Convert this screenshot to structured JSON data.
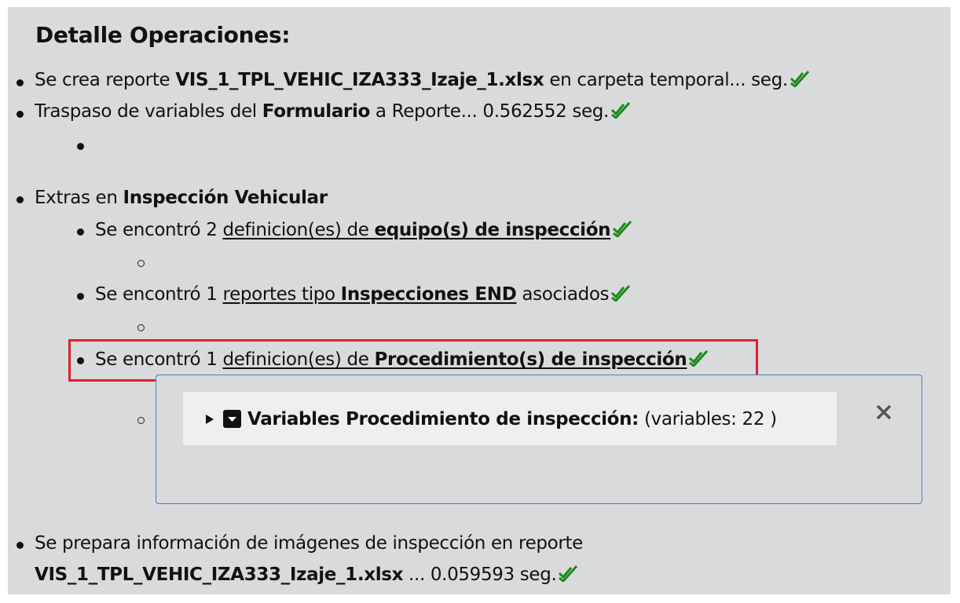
{
  "title": "Detalle Operaciones:",
  "items": {
    "create_report": {
      "pre": "Se crea reporte ",
      "file": "VIS_1_TPL_VEHIC_IZA333_Izaje_1.xlsx",
      "post": " en carpeta temporal... seg."
    },
    "transfer": {
      "pre": "Traspaso de variables del ",
      "bold": "Formulario",
      "post": " a Reporte... 0.562552 seg."
    },
    "extras": {
      "pre": "Extras en ",
      "bold": "Inspección Vehicular"
    },
    "equipos": {
      "pre": "Se encontró 2 ",
      "link_pre": "definicion(es) de ",
      "link_bold": "equipo(s) de inspección"
    },
    "reportes": {
      "pre": "Se encontró 1 ",
      "link_pre": "reportes tipo ",
      "link_bold": "Inspecciones END",
      "post": " asociados"
    },
    "procedimientos": {
      "pre": "Se encontró 1 ",
      "link_pre": "definicion(es) de ",
      "link_bold": "Procedimiento(s) de inspección"
    },
    "images": {
      "line1": "Se prepara información de imágenes de inspección en reporte",
      "file": "VIS_1_TPL_VEHIC_IZA333_Izaje_1.xlsx",
      "post": " ... 0.059593 seg."
    }
  },
  "popup": {
    "summary_label": "Variables Procedimiento de inspección:",
    "summary_count": "(variables: 22 )",
    "close_icon": "close-x-icon"
  },
  "colors": {
    "panel_bg": "#d9dadc",
    "check_green": "#1a8a1a",
    "highlight_red": "#e0202c",
    "popup_border": "#4a7bc6"
  }
}
